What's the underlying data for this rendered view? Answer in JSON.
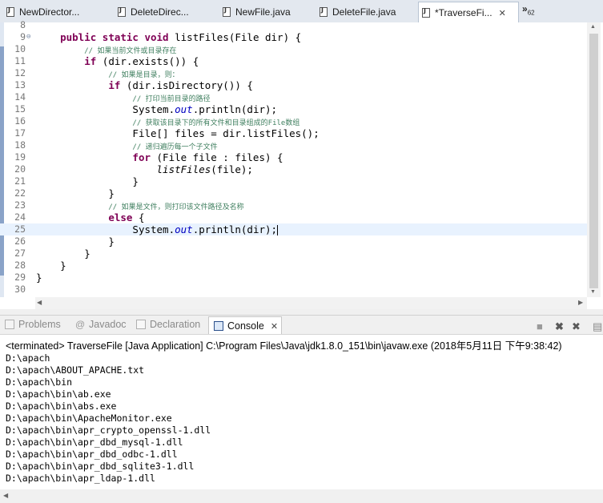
{
  "editor_tabs": [
    {
      "label": "NewDirector...",
      "active": false
    },
    {
      "label": "DeleteDirec...",
      "active": false
    },
    {
      "label": "NewFile.java",
      "active": false
    },
    {
      "label": "DeleteFile.java",
      "active": false
    },
    {
      "label": "*TraverseFi...",
      "active": true
    }
  ],
  "more_tabs": {
    "glyph": "»",
    "count": "62"
  },
  "code_lines": [
    {
      "n": "8"
    },
    {
      "n": "9"
    },
    {
      "n": "10",
      "comment": "// 如果当前文件或目录存在"
    },
    {
      "n": "11"
    },
    {
      "n": "12",
      "comment": "// 如果是目录，则："
    },
    {
      "n": "13"
    },
    {
      "n": "14",
      "comment": "// 打印当前目录的路径"
    },
    {
      "n": "15"
    },
    {
      "n": "16",
      "comment": "// 获取该目录下的所有文件和目录组成的File数组"
    },
    {
      "n": "17"
    },
    {
      "n": "18",
      "comment": "// 递归遍历每一个子文件"
    },
    {
      "n": "19"
    },
    {
      "n": "20"
    },
    {
      "n": "21"
    },
    {
      "n": "22"
    },
    {
      "n": "23",
      "comment": "// 如果是文件，则打印该文件路径及名称"
    },
    {
      "n": "24"
    },
    {
      "n": "25"
    },
    {
      "n": "26"
    },
    {
      "n": "27"
    },
    {
      "n": "28"
    },
    {
      "n": "29"
    },
    {
      "n": "30"
    }
  ],
  "code": {
    "kw_public": "public",
    "kw_static": "static",
    "kw_void": "void",
    "sig": " listFiles(File dir) {",
    "kw_if": "if",
    "exists": " (dir.exists()) {",
    "isdir": " (dir.isDirectory()) {",
    "sys": "System.",
    "out": "out",
    "println": ".println(dir);",
    "arr": "File[] files = dir.listFiles();",
    "kw_for": "for",
    "forrest": " (File file : files) {",
    "rec": "listFiles",
    "recargs": "(file);",
    "close": "}",
    "kw_else": "else",
    "brace": " {"
  },
  "console_tabs": [
    {
      "label": "Problems",
      "active": false
    },
    {
      "label": "Javadoc",
      "active": false
    },
    {
      "label": "Declaration",
      "active": false
    },
    {
      "label": "Console",
      "active": true
    }
  ],
  "console": {
    "terminated": "<terminated> TraverseFile [Java Application] C:\\Program Files\\Java\\jdk1.8.0_151\\bin\\javaw.exe (2018年5月11日 下午9:38:42)",
    "output": [
      "D:\\apach",
      "D:\\apach\\ABOUT_APACHE.txt",
      "D:\\apach\\bin",
      "D:\\apach\\bin\\ab.exe",
      "D:\\apach\\bin\\abs.exe",
      "D:\\apach\\bin\\ApacheMonitor.exe",
      "D:\\apach\\bin\\apr_crypto_openssl-1.dll",
      "D:\\apach\\bin\\apr_dbd_mysql-1.dll",
      "D:\\apach\\bin\\apr_dbd_odbc-1.dll",
      "D:\\apach\\bin\\apr_dbd_sqlite3-1.dll",
      "D:\\apach\\bin\\apr_ldap-1.dll"
    ]
  },
  "colors": {
    "keyword": "#7f0055",
    "comment": "#3f7f5f",
    "field": "#0000c0",
    "line_number": "#787878"
  }
}
